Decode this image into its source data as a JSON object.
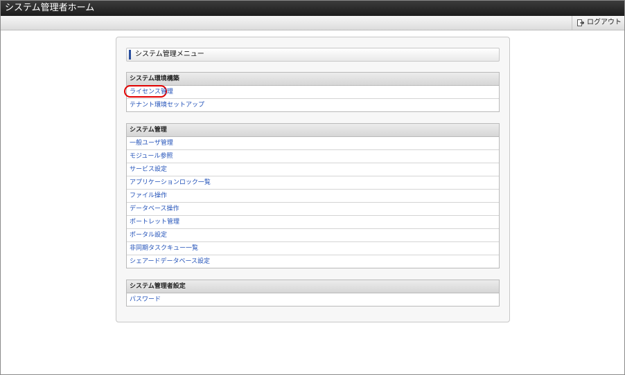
{
  "window": {
    "title": "システム管理者ホーム"
  },
  "toolbar": {
    "logout_label": "ログアウト",
    "logout_icon": "logout-icon"
  },
  "menu": {
    "title": "システム管理メニュー",
    "sections": [
      {
        "header": "システム環境構築",
        "items": [
          "ライセンス管理",
          "テナント環境セットアップ"
        ]
      },
      {
        "header": "システム管理",
        "items": [
          "一般ユーザ管理",
          "モジュール参照",
          "サービス設定",
          "アプリケーションロック一覧",
          "ファイル操作",
          "データベース操作",
          "ポートレット管理",
          "ポータル設定",
          "非同期タスクキュー一覧",
          "シェアードデータベース設定"
        ]
      },
      {
        "header": "システム管理者設定",
        "items": [
          "パスワード"
        ]
      }
    ]
  },
  "highlight": {
    "color": "#e10000"
  },
  "colors": {
    "link": "#2050b8",
    "accent_bar": "#2a4f9e",
    "titlebar": "#1c1c1c"
  }
}
